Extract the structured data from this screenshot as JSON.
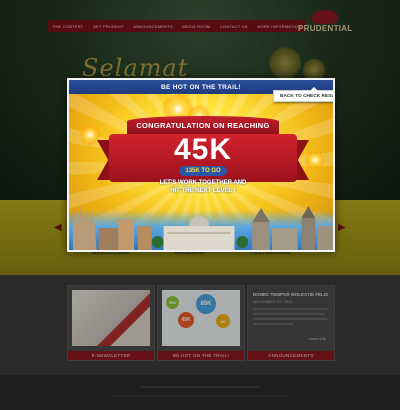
{
  "nav": {
    "items": [
      "THE CONTEST",
      "GET PRUDENT",
      "ANNOUNCEMENTS",
      "MEDIA ROOM",
      "CONTACT US",
      "MORE INFORMATION"
    ]
  },
  "brand": {
    "logo_text": "PRUDENTIAL",
    "logo_icon": "rock-icon"
  },
  "hero": {
    "greeting": "Selamat"
  },
  "places": {
    "labels": [
      "BARCELONA",
      "VALENCIA",
      "TESTIMONIAL"
    ]
  },
  "cards": [
    {
      "footer": "E-NEWSLETTER"
    },
    {
      "footer": "BE HOT ON THE TRAIL!",
      "bubbles": [
        "85K",
        "45K",
        "35K",
        "5K"
      ]
    },
    {
      "footer": "ANNOUNCEMENTS",
      "title": "DONEC TEMPOR MOLESTIE FELIS",
      "date": "NOVEMBER 02, 2012",
      "more": "more info"
    }
  ],
  "modal": {
    "header": "BE HOT ON THE TRAIL!",
    "back_button": "BACK TO CHECK RESULT",
    "congrats": "CONGRATULATION ON REACHING",
    "milestone": "45K",
    "to_go": "135K TO GO",
    "message_line1": "LET'S WORK TOGETHER AND",
    "message_line2": "HIT THE NEXT LEVEL !"
  },
  "colors": {
    "brand_red": "#8c1820",
    "header_blue": "#1d3a7d",
    "accent_yellow": "#ffe23a"
  }
}
